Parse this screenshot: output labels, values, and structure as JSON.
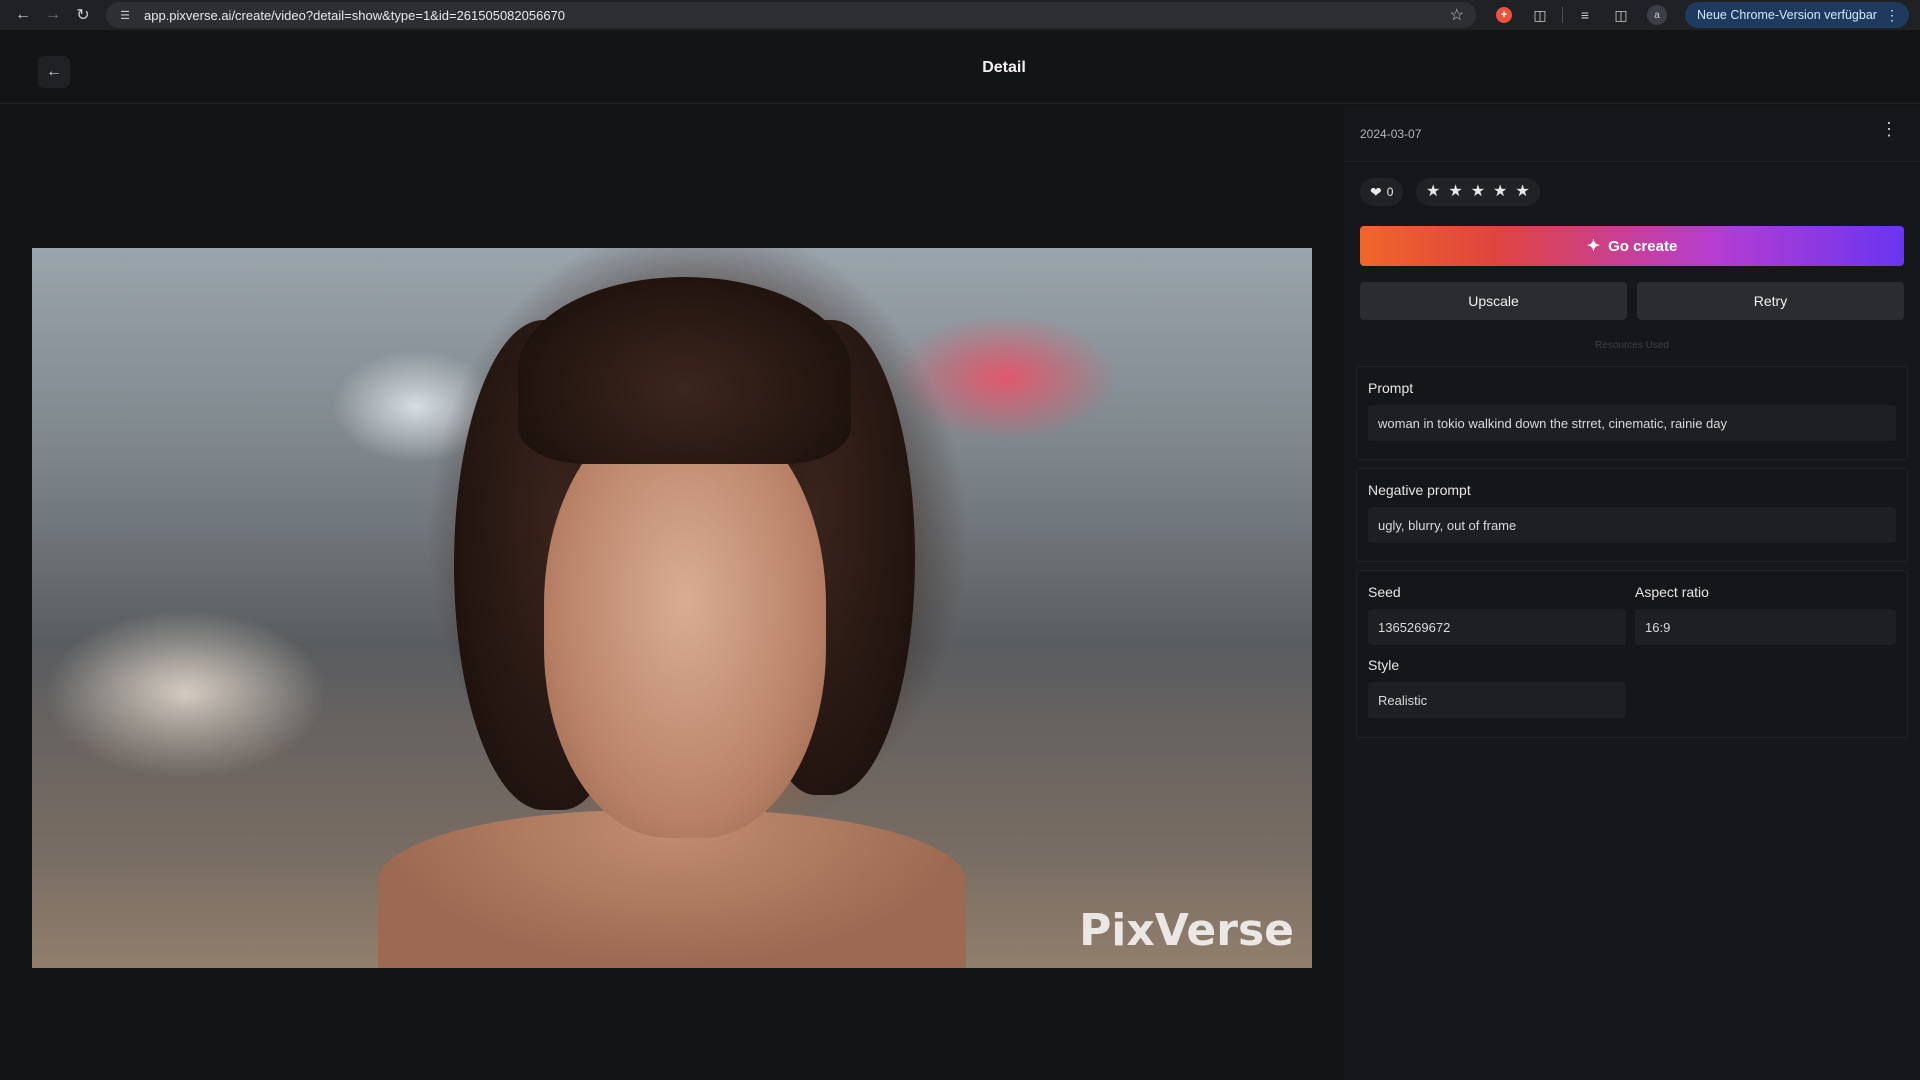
{
  "browser": {
    "url": "app.pixverse.ai/create/video?detail=show&type=1&id=261505082056670",
    "update_label": "Neue Chrome-Version verfügbar",
    "profile_initial": "a"
  },
  "header": {
    "title": "Detail"
  },
  "video": {
    "watermark": "PixVerse"
  },
  "panel": {
    "date": "2024-03-07",
    "likes": "0",
    "rating_stars": 5,
    "go_create_label": "Go create",
    "upscale_label": "Upscale",
    "retry_label": "Retry",
    "resources_label": "Resources Used",
    "prompt": {
      "label": "Prompt",
      "value": "woman in tokio walkind down the strret, cinematic, rainie day"
    },
    "negative_prompt": {
      "label": "Negative prompt",
      "value": "ugly, blurry, out of frame"
    },
    "seed": {
      "label": "Seed",
      "value": "1365269672"
    },
    "aspect_ratio": {
      "label": "Aspect ratio",
      "value": "16:9"
    },
    "style": {
      "label": "Style",
      "value": "Realistic"
    }
  },
  "colors": {
    "background": "#131416",
    "panel": "#16171a",
    "gradient_start": "#f0662a",
    "gradient_end": "#6a35f0"
  }
}
